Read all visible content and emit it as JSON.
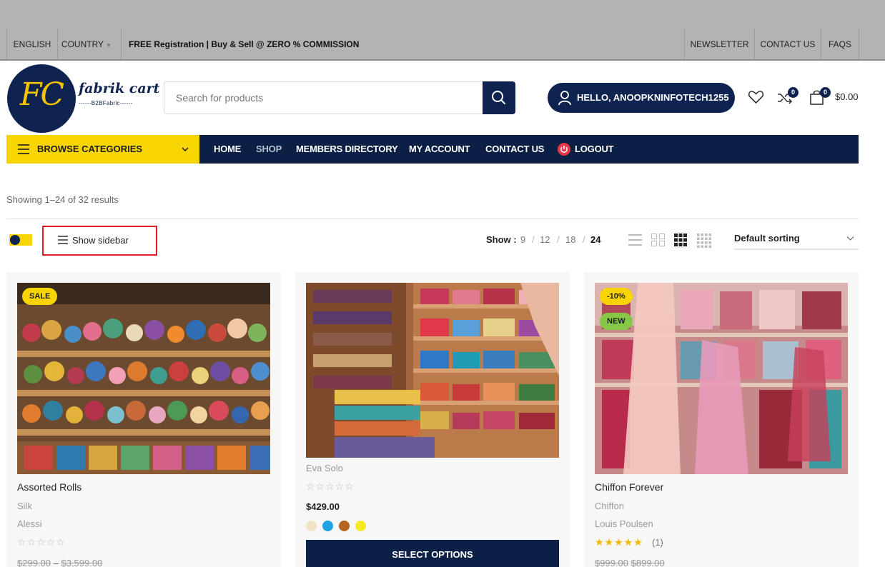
{
  "topbar": {
    "language": "ENGLISH",
    "country": "COUNTRY",
    "promo": "FREE Registration | Buy & Sell @ ZERO % COMMISSION",
    "newsletter": "NEWSLETTER",
    "contact": "CONTACT US",
    "faqs": "FAQS"
  },
  "logo": {
    "initials": "FC",
    "name": "fabrik cart",
    "tagline": "------B2BFabric------"
  },
  "search": {
    "placeholder": "Search for products"
  },
  "account": {
    "greeting": "HELLO, ANOOPKNINFOTECH1255"
  },
  "header_icons": {
    "wishlist_icon": "heart-icon",
    "compare_icon": "shuffle-icon",
    "compare_count": "0",
    "cart_icon": "shopping-bag-icon",
    "cart_count": "0",
    "cart_total": "$0.00"
  },
  "nav": {
    "browse": "BROWSE CATEGORIES",
    "links": [
      "HOME",
      "SHOP",
      "MEMBERS DIRECTORY",
      "MY ACCOUNT",
      "CONTACT US",
      "LOGOUT"
    ]
  },
  "shop": {
    "results": "Showing 1–24 of 32 results",
    "show_sidebar": "Show sidebar",
    "show_label": "Show :",
    "per_page": [
      "9",
      "12",
      "18",
      "24"
    ],
    "per_page_active": "24",
    "view_icons": [
      "list-view-icon",
      "grid-2-icon",
      "grid-3-icon",
      "grid-4-icon"
    ],
    "sorting": "Default sorting"
  },
  "products": [
    {
      "badges": [
        "SALE"
      ],
      "title": "Assorted Rolls",
      "category": "Silk",
      "brand": "Alessi",
      "rating": 0,
      "price_old": "$299.00",
      "price_dash": "–",
      "price_cur": "$3,599.00"
    },
    {
      "brand": "Eva Solo",
      "rating": 0,
      "price": "$429.00",
      "swatches": [
        "#f1e3c4",
        "#1fa2e6",
        "#b5651d",
        "#f5ea26"
      ],
      "button": "SELECT OPTIONS"
    },
    {
      "badges": [
        "-10%",
        "NEW"
      ],
      "title": "Chiffon Forever",
      "category": "Chiffon",
      "brand": "Louis Poulsen",
      "rating": 5,
      "reviews": "(1)",
      "price_old": "$999.00",
      "price_cur": "$899.00"
    }
  ]
}
